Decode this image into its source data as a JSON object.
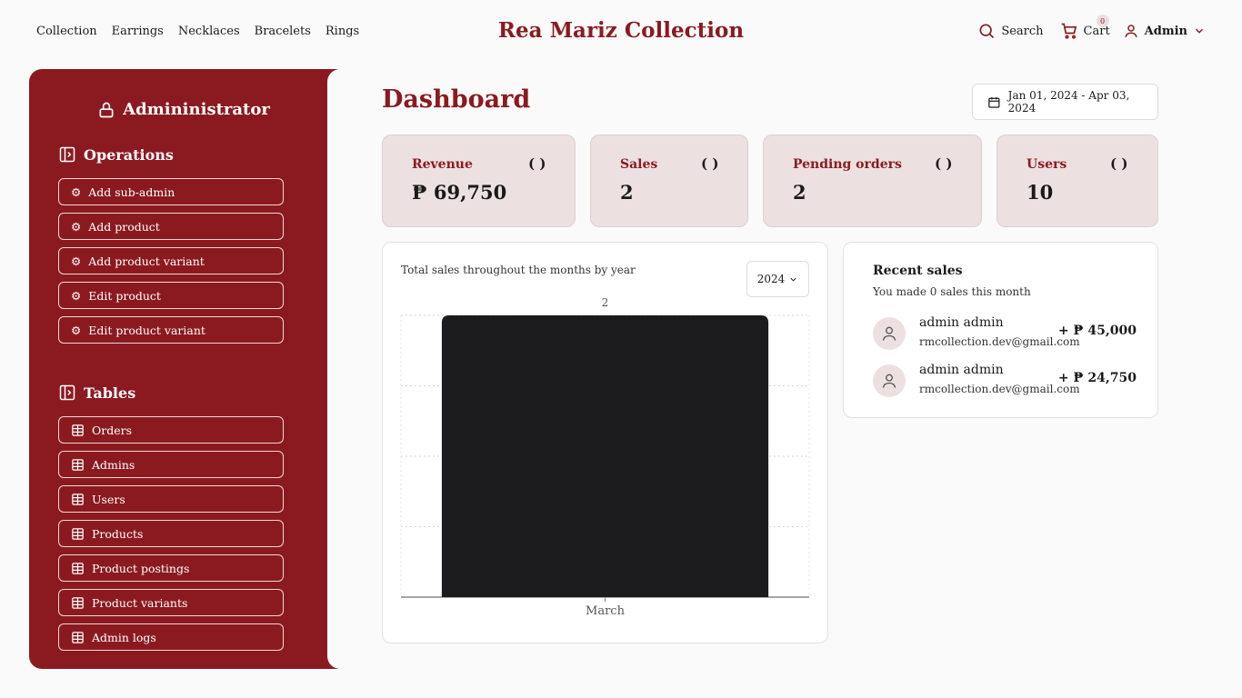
{
  "nav": {
    "links": [
      "Collection",
      "Earrings",
      "Necklaces",
      "Bracelets",
      "Rings"
    ],
    "brand": "Rea Mariz Collection",
    "search_label": "Search",
    "cart_label": "Cart",
    "cart_count": "0",
    "account_label": "Admin"
  },
  "sidebar": {
    "title": "Admininistrator",
    "operations_heading": "Operations",
    "operations": [
      "Add sub-admin",
      "Add product",
      "Add product variant",
      "Edit product",
      "Edit product variant"
    ],
    "tables_heading": "Tables",
    "tables": [
      "Orders",
      "Admins",
      "Users",
      "Products",
      "Product postings",
      "Product variants",
      "Admin logs"
    ]
  },
  "main": {
    "title": "Dashboard",
    "date_range": "Jan 01, 2024 - Apr 03, 2024",
    "stats": [
      {
        "label": "Revenue",
        "icon": "( )",
        "value": "₱ 69,750"
      },
      {
        "label": "Sales",
        "icon": "( )",
        "value": "2"
      },
      {
        "label": "Pending orders",
        "icon": "( )",
        "value": "2"
      },
      {
        "label": "Users",
        "icon": "( )",
        "value": "10"
      }
    ],
    "chart_caption": "Total sales throughout the months by year",
    "year": "2024",
    "recent_sales": {
      "title": "Recent sales",
      "subtitle": "You made 0 sales this month",
      "rows": [
        {
          "name": "admin admin",
          "email": "rmcollection.dev@gmail.com",
          "amount": "+ ₱ 45,000"
        },
        {
          "name": "admin admin",
          "email": "rmcollection.dev@gmail.com",
          "amount": "+ ₱ 24,750"
        }
      ]
    }
  },
  "colors": {
    "brand": "#8b1a20",
    "card": "#ece1e0",
    "bar": "#1c1c1e"
  },
  "chart_data": {
    "type": "bar",
    "categories": [
      "March"
    ],
    "values": [
      2
    ],
    "title": "",
    "xlabel": "",
    "ylabel": "",
    "ylim": [
      0,
      2
    ],
    "grid": true
  }
}
